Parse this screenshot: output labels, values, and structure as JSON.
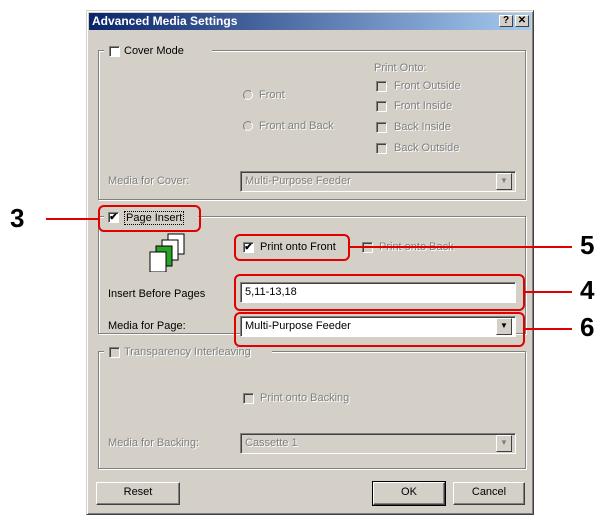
{
  "dialog": {
    "title": "Advanced Media Settings",
    "help_btn": "?",
    "close_btn": "✕"
  },
  "cover": {
    "checkbox_label": "Cover Mode",
    "print_onto_title": "Print Onto:",
    "radio_front": "Front",
    "radio_front_back": "Front and Back",
    "cb_front_outside": "Front Outside",
    "cb_front_inside": "Front Inside",
    "cb_back_inside": "Back Inside",
    "cb_back_outside": "Back Outside",
    "media_label": "Media for Cover:",
    "media_value": "Multi-Purpose Feeder"
  },
  "insert": {
    "checkbox_label": "Page Insert",
    "checked_mark": "✔",
    "print_front": "Print onto Front",
    "print_back": "Print onto Back",
    "pages_label": "Insert Before Pages",
    "pages_value": "5,11-13,18",
    "media_label": "Media for Page:",
    "media_value": "Multi-Purpose Feeder"
  },
  "transparency": {
    "checkbox_label": "Transparency Interleaving",
    "print_backing": "Print onto Backing",
    "media_label": "Media for Backing:",
    "media_value": "Cassette 1"
  },
  "buttons": {
    "reset": "Reset",
    "ok": "OK",
    "cancel": "Cancel"
  },
  "callouts": {
    "n3": "3",
    "n4": "4",
    "n5": "5",
    "n6": "6",
    "color": "#e00000"
  },
  "dropdown_arrow": "▼"
}
